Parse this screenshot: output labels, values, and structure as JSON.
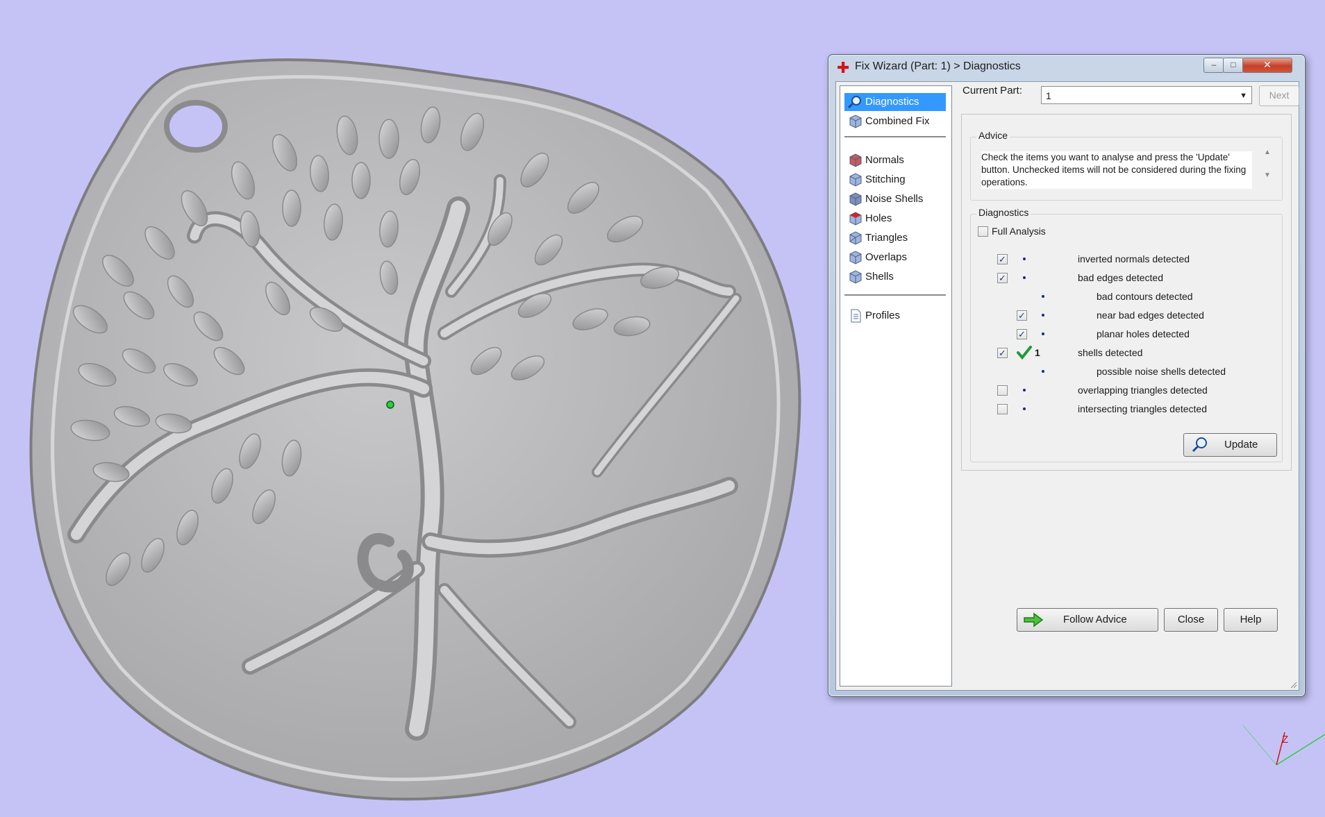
{
  "window": {
    "title": "Fix Wizard (Part: 1) > Diagnostics",
    "minimize_label": "–",
    "maximize_label": "□",
    "close_label": "✕"
  },
  "sidebar": {
    "items": [
      {
        "label": "Diagnostics",
        "icon": "magnifier-icon",
        "selected": true
      },
      {
        "label": "Combined Fix",
        "icon": "cube-icon"
      },
      {
        "label": "Normals",
        "icon": "cube-icon"
      },
      {
        "label": "Stitching",
        "icon": "cube-icon"
      },
      {
        "label": "Noise Shells",
        "icon": "cube-icon"
      },
      {
        "label": "Holes",
        "icon": "cube-icon"
      },
      {
        "label": "Triangles",
        "icon": "cube-icon"
      },
      {
        "label": "Overlaps",
        "icon": "cube-icon"
      },
      {
        "label": "Shells",
        "icon": "cube-icon"
      },
      {
        "label": "Profiles",
        "icon": "document-icon"
      }
    ]
  },
  "header": {
    "current_part_label": "Current Part:",
    "current_part_value": "1",
    "next_label": "Next"
  },
  "advice": {
    "title": "Advice",
    "text": "Check the items you want to analyse and press the 'Update' button. Unchecked items will not be considered during the fixing operations."
  },
  "diagnostics": {
    "title": "Diagnostics",
    "full_analysis_label": "Full Analysis",
    "full_analysis_checked": false,
    "items": [
      {
        "label": "inverted normals detected",
        "checked": true,
        "result": ""
      },
      {
        "label": "bad edges detected",
        "checked": true,
        "result": ""
      },
      {
        "label": "bad contours detected",
        "checked": null,
        "result": ""
      },
      {
        "label": "near bad edges detected",
        "checked": true,
        "result": ""
      },
      {
        "label": "planar holes detected",
        "checked": true,
        "result": ""
      },
      {
        "label": "shells detected",
        "checked": true,
        "result": "1"
      },
      {
        "label": "possible noise shells detected",
        "checked": null,
        "result": ""
      },
      {
        "label": "overlapping triangles detected",
        "checked": false,
        "result": ""
      },
      {
        "label": "intersecting triangles detected",
        "checked": false,
        "result": ""
      }
    ],
    "update_label": "Update"
  },
  "footer": {
    "follow_advice_label": "Follow Advice",
    "close_label": "Close",
    "help_label": "Help"
  },
  "viewport": {
    "axis_label": "Z",
    "background_color": "#c5c3f6",
    "model_color": "#b9b9bb"
  }
}
